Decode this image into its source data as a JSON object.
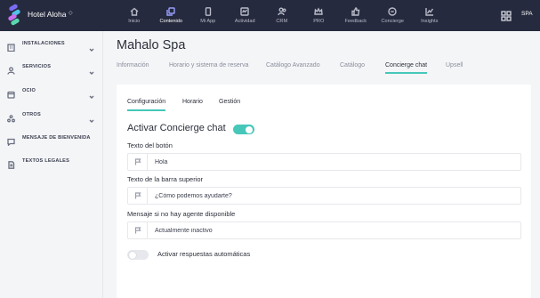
{
  "header": {
    "hotel_name": "Hotel Aloha",
    "hotel_caret": "◇",
    "nav": [
      {
        "label": "Inicio",
        "icon": "home-icon"
      },
      {
        "label": "Contenido",
        "icon": "content-icon",
        "active": true
      },
      {
        "label": "Mi App",
        "icon": "phone-icon"
      },
      {
        "label": "Actividad",
        "icon": "activity-icon"
      },
      {
        "label": "CRM",
        "icon": "users-icon"
      },
      {
        "label": "PRO",
        "icon": "crown-icon"
      },
      {
        "label": "Feedback",
        "icon": "thumbs-up-icon"
      },
      {
        "label": "Concierge",
        "icon": "chat-icon"
      },
      {
        "label": "Insights",
        "icon": "chart-icon"
      }
    ],
    "language": "SPA",
    "accent_color": "#9aa0ff"
  },
  "sidebar": {
    "items": [
      {
        "label": "INSTALACIONES",
        "icon": "building-icon",
        "has_chevron": true
      },
      {
        "label": "SERVICIOS",
        "icon": "person-icon",
        "has_chevron": true
      },
      {
        "label": "OCIO",
        "icon": "ticket-icon",
        "has_chevron": true
      },
      {
        "label": "OTROS",
        "icon": "dots-icon",
        "has_chevron": true
      },
      {
        "label": "MENSAJE DE BIENVENIDA",
        "icon": "message-icon",
        "has_chevron": false
      },
      {
        "label": "TEXTOS LEGALES",
        "icon": "document-icon",
        "has_chevron": false
      }
    ]
  },
  "main": {
    "title": "Mahalo Spa",
    "tabs": [
      {
        "label": "Información"
      },
      {
        "label": "Horario y sistema de reserva"
      },
      {
        "label": "Catálogo Avanzado"
      },
      {
        "label": "Catálogo"
      },
      {
        "label": "Concierge chat",
        "active": true
      },
      {
        "label": "Upsell"
      }
    ],
    "subtabs": [
      {
        "label": "Configuración",
        "active": true
      },
      {
        "label": "Horario"
      },
      {
        "label": "Gestión"
      }
    ],
    "activate_label": "Activar Concierge chat",
    "activate_on": true,
    "fields": [
      {
        "label": "Texto del botón",
        "value": "Hola"
      },
      {
        "label": "Texto de la barra superior",
        "value": "¿Cómo podemos ayudarte?"
      },
      {
        "label": "Mensaje si no hay agente disponible",
        "value": "Actualmente inactivo"
      }
    ],
    "auto_reply_label": "Activar respuestas automáticas",
    "auto_reply_on": false,
    "toggle_color": "#46c7b9"
  }
}
